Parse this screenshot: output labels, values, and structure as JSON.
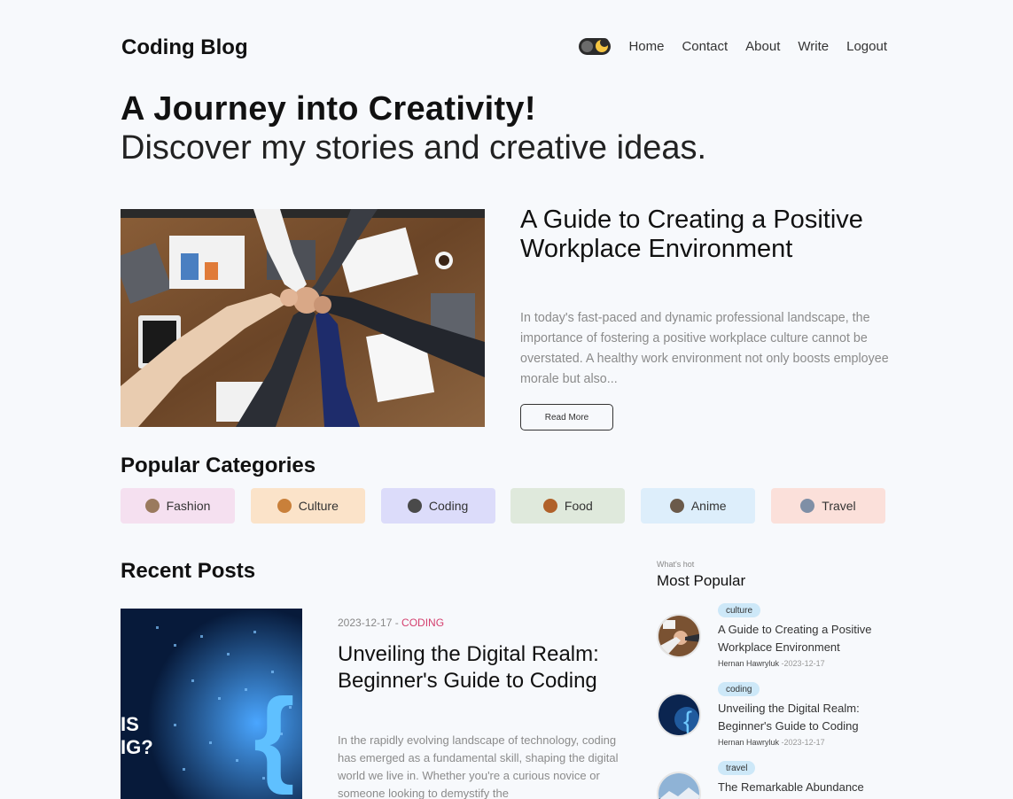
{
  "header": {
    "logo": "Coding Blog",
    "nav": [
      "Home",
      "Contact",
      "About",
      "Write",
      "Logout"
    ]
  },
  "hero": {
    "title": "A Journey into Creativity!",
    "subtitle": "Discover my stories and creative ideas."
  },
  "featured": {
    "title": "A Guide to Creating a Positive Workplace Environment",
    "excerpt": "In today's fast-paced and dynamic professional landscape, the importance of fostering a positive workplace culture cannot be overstated. A healthy work environment not only boosts employee morale but also...",
    "read_more": "Read More"
  },
  "categories": {
    "title": "Popular Categories",
    "items": [
      {
        "label": "Fashion",
        "bg": "#f5e0f0",
        "icon": "fashion-icon"
      },
      {
        "label": "Culture",
        "bg": "#fbe3c9",
        "icon": "culture-icon"
      },
      {
        "label": "Coding",
        "bg": "#dcdcfa",
        "icon": "coding-icon"
      },
      {
        "label": "Food",
        "bg": "#dfe9dc",
        "icon": "food-icon"
      },
      {
        "label": "Anime",
        "bg": "#ddeefb",
        "icon": "anime-icon"
      },
      {
        "label": "Travel",
        "bg": "#fbe0da",
        "icon": "travel-icon"
      }
    ]
  },
  "recent": {
    "title": "Recent Posts",
    "post": {
      "date": "2023-12-17 - ",
      "category": "CODING",
      "title": "Unveiling the Digital Realm: Beginner's Guide to Coding",
      "excerpt": "In the rapidly evolving landscape of technology, coding has emerged as a fundamental skill, shaping the digital world we live in. Whether you're a curious novice or someone looking to demystify the",
      "image_text": "IS\nIG?"
    }
  },
  "popular": {
    "label": "What's hot",
    "title": "Most Popular",
    "items": [
      {
        "tag": "culture",
        "tag_bg": "#cde8f8",
        "title": "A Guide to Creating a Positive Workplace Environment",
        "author": "Hernan Hawryluk",
        "date": "-2023-12-17"
      },
      {
        "tag": "coding",
        "tag_bg": "#cde8f8",
        "title": "Unveiling the Digital Realm: Beginner's Guide to Coding",
        "author": "Hernan Hawryluk",
        "date": "-2023-12-17"
      },
      {
        "tag": "travel",
        "tag_bg": "#cde8f8",
        "title": "The Remarkable Abundance",
        "author": "",
        "date": ""
      }
    ]
  }
}
